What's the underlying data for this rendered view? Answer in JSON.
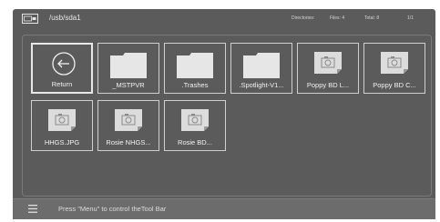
{
  "header": {
    "usb_icon": "usb-drive-icon",
    "path": "/usb/sda1",
    "directories_label": "Directories:",
    "files_label": "Files: 4",
    "total_label": "Total: 8",
    "page_label": "1/1"
  },
  "items": [
    {
      "label": "Return",
      "type": "return",
      "icon": "return-arrow-icon",
      "selected": true
    },
    {
      "label": "_MSTPVR",
      "type": "folder",
      "icon": "folder-icon"
    },
    {
      "label": ".Trashes",
      "type": "folder",
      "icon": "folder-icon"
    },
    {
      "label": ".Spotlight-V1...",
      "type": "folder",
      "icon": "folder-icon"
    },
    {
      "label": "Poppy BD  L...",
      "type": "photo",
      "icon": "photo-file-icon"
    },
    {
      "label": "Poppy BD C...",
      "type": "photo",
      "icon": "photo-file-icon"
    },
    {
      "label": "HHGS.JPG",
      "type": "photo",
      "icon": "photo-file-icon"
    },
    {
      "label": "Rosie NHGS...",
      "type": "photo",
      "icon": "photo-file-icon"
    },
    {
      "label": "Rosie BD...",
      "type": "photo",
      "icon": "photo-file-icon"
    }
  ],
  "footer": {
    "menu_icon": "menu-icon",
    "hint": "Press \"Menu\" to control theTool Bar"
  },
  "colors": {
    "panel": "#5b5b5b",
    "tile_border": "#cfcfcf",
    "text": "#f2f2f2"
  }
}
